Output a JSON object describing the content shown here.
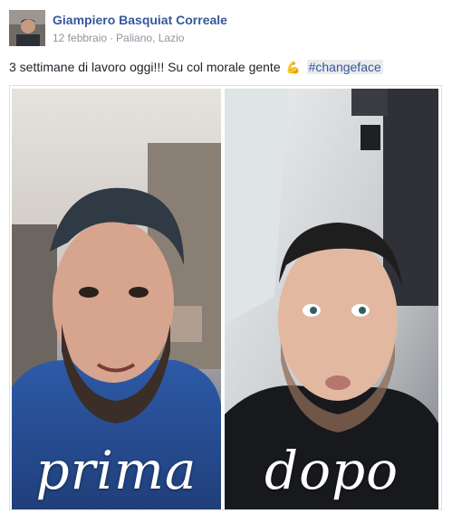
{
  "post": {
    "author": "Giampiero Basquiat Correale",
    "date": "12 febbraio",
    "separator": "·",
    "location": "Paliano, Lazio",
    "text": "3 settimane di lavoro oggi!!! Su col morale gente",
    "emoji": "💪",
    "emoji_name": "flexed-biceps-icon",
    "hashtag": "#changeface"
  },
  "photos": {
    "left_caption": "prima",
    "right_caption": "dopo"
  },
  "colors": {
    "link": "#365899",
    "meta": "#90949c",
    "hashtag_bg": "#e9ebee"
  }
}
